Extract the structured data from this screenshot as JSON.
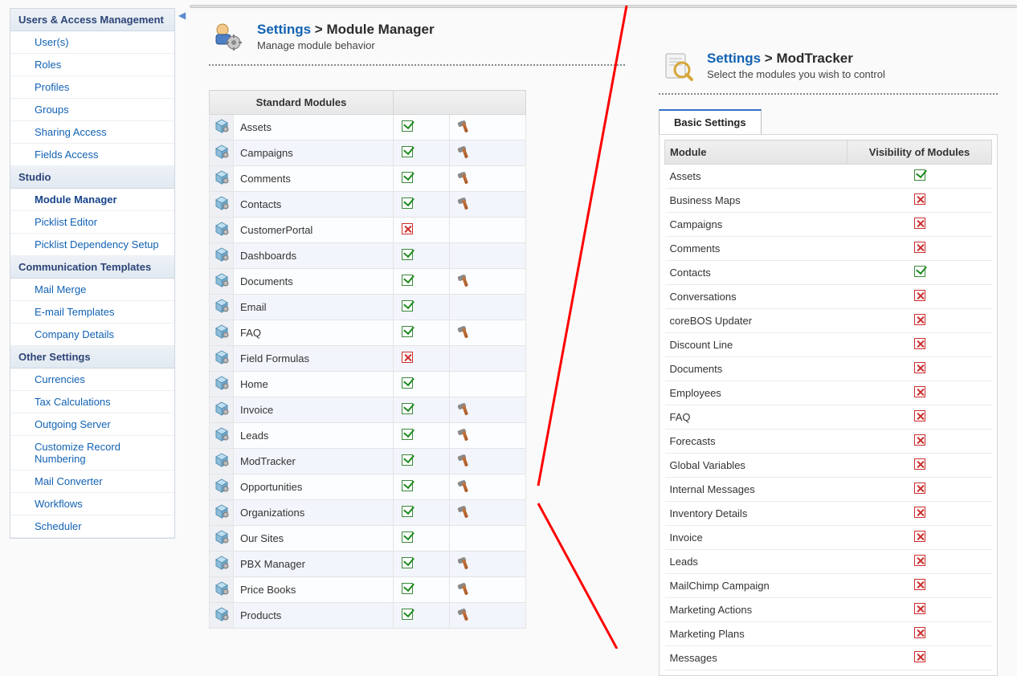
{
  "sidebar": {
    "sections": [
      {
        "header": "Users & Access Management",
        "items": [
          "User(s)",
          "Roles",
          "Profiles",
          "Groups",
          "Sharing Access",
          "Fields Access"
        ]
      },
      {
        "header": "Studio",
        "items": [
          "Module Manager",
          "Picklist Editor",
          "Picklist Dependency Setup"
        ],
        "active_index": 0
      },
      {
        "header": "Communication Templates",
        "items": [
          "Mail Merge",
          "E-mail Templates",
          "Company Details"
        ]
      },
      {
        "header": "Other Settings",
        "items": [
          "Currencies",
          "Tax Calculations",
          "Outgoing Server",
          "Customize Record Numbering",
          "Mail Converter",
          "Workflows",
          "Scheduler"
        ]
      }
    ]
  },
  "left_panel": {
    "crumb_link": "Settings",
    "crumb_sep": " > ",
    "crumb_current": "Module Manager",
    "subtitle": "Manage module behavior",
    "table_header": "Standard Modules",
    "rows": [
      {
        "name": "Assets",
        "enabled": true,
        "tools": true
      },
      {
        "name": "Campaigns",
        "enabled": true,
        "tools": true
      },
      {
        "name": "Comments",
        "enabled": true,
        "tools": true
      },
      {
        "name": "Contacts",
        "enabled": true,
        "tools": true
      },
      {
        "name": "CustomerPortal",
        "enabled": false,
        "tools": false
      },
      {
        "name": "Dashboards",
        "enabled": true,
        "tools": false
      },
      {
        "name": "Documents",
        "enabled": true,
        "tools": true
      },
      {
        "name": "Email",
        "enabled": true,
        "tools": false
      },
      {
        "name": "FAQ",
        "enabled": true,
        "tools": true
      },
      {
        "name": "Field Formulas",
        "enabled": false,
        "tools": false
      },
      {
        "name": "Home",
        "enabled": true,
        "tools": false
      },
      {
        "name": "Invoice",
        "enabled": true,
        "tools": true
      },
      {
        "name": "Leads",
        "enabled": true,
        "tools": true
      },
      {
        "name": "ModTracker",
        "enabled": true,
        "tools": true
      },
      {
        "name": "Opportunities",
        "enabled": true,
        "tools": true
      },
      {
        "name": "Organizations",
        "enabled": true,
        "tools": true
      },
      {
        "name": "Our Sites",
        "enabled": true,
        "tools": false
      },
      {
        "name": "PBX Manager",
        "enabled": true,
        "tools": true
      },
      {
        "name": "Price Books",
        "enabled": true,
        "tools": true
      },
      {
        "name": "Products",
        "enabled": true,
        "tools": true
      }
    ]
  },
  "right_panel": {
    "crumb_link": "Settings",
    "crumb_sep": " > ",
    "crumb_current": "ModTracker",
    "subtitle": "Select the modules you wish to control",
    "tab_label": "Basic Settings",
    "col_module": "Module",
    "col_visibility": "Visibility of Modules",
    "rows": [
      {
        "name": "Assets",
        "visible": true
      },
      {
        "name": "Business Maps",
        "visible": false
      },
      {
        "name": "Campaigns",
        "visible": false
      },
      {
        "name": "Comments",
        "visible": false
      },
      {
        "name": "Contacts",
        "visible": true
      },
      {
        "name": "Conversations",
        "visible": false
      },
      {
        "name": "coreBOS Updater",
        "visible": false
      },
      {
        "name": "Discount Line",
        "visible": false
      },
      {
        "name": "Documents",
        "visible": false
      },
      {
        "name": "Employees",
        "visible": false
      },
      {
        "name": "FAQ",
        "visible": false
      },
      {
        "name": "Forecasts",
        "visible": false
      },
      {
        "name": "Global Variables",
        "visible": false
      },
      {
        "name": "Internal Messages",
        "visible": false
      },
      {
        "name": "Inventory Details",
        "visible": false
      },
      {
        "name": "Invoice",
        "visible": false
      },
      {
        "name": "Leads",
        "visible": false
      },
      {
        "name": "MailChimp Campaign",
        "visible": false
      },
      {
        "name": "Marketing Actions",
        "visible": false
      },
      {
        "name": "Marketing Plans",
        "visible": false
      },
      {
        "name": "Messages",
        "visible": false
      }
    ]
  }
}
